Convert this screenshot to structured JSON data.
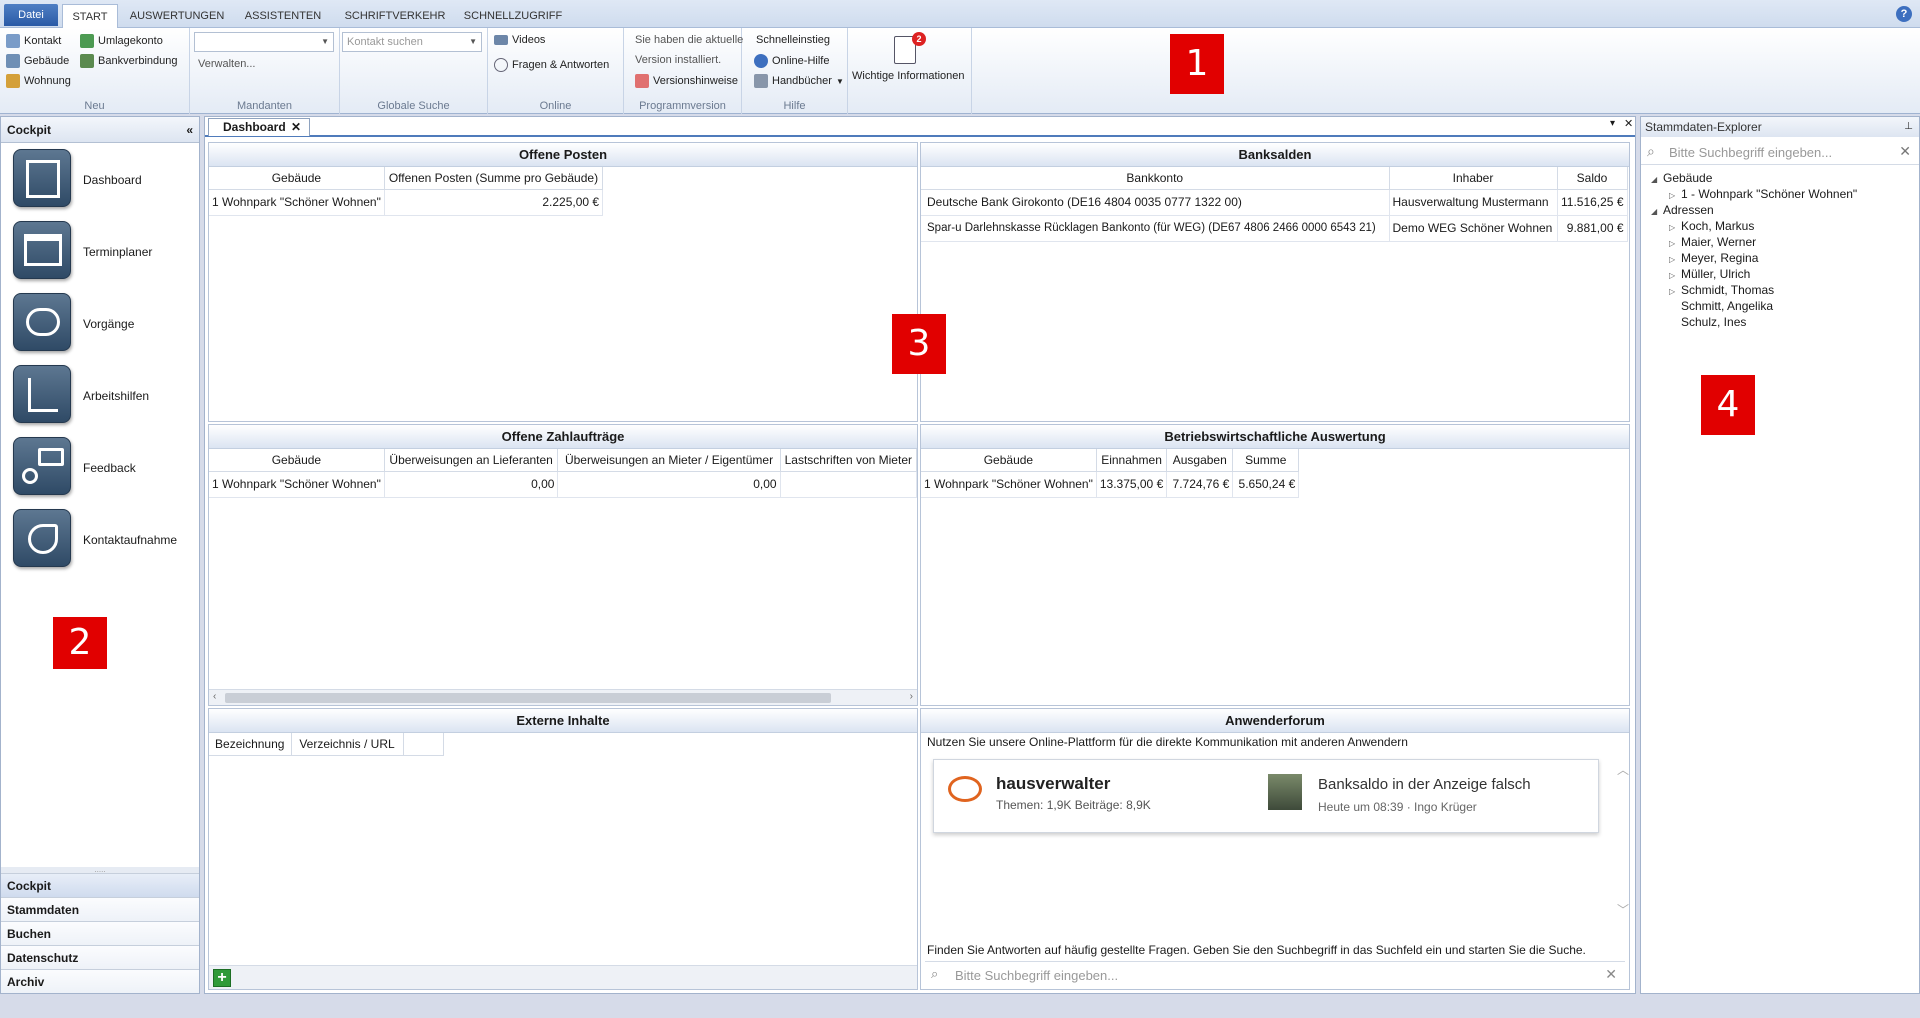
{
  "ribbon": {
    "tabs": [
      "Datei",
      "START",
      "AUSWERTUNGEN",
      "ASSISTENTEN",
      "SCHRIFTVERKEHR",
      "SCHNELLZUGRIFF"
    ],
    "groups": {
      "neu": {
        "label": "Neu",
        "items": [
          "Kontakt",
          "Gebäude",
          "Wohnung",
          "Umlagekonto",
          "Bankverbindung"
        ]
      },
      "mandanten": {
        "label": "Mandanten",
        "manage": "Verwalten..."
      },
      "suche": {
        "label": "Globale Suche",
        "placeholder": "Kontakt suchen"
      },
      "online": {
        "label": "Online",
        "items": [
          "Videos",
          "Fragen & Antworten"
        ]
      },
      "programmversion": {
        "label": "Programmversion",
        "line1": "Sie haben die aktuelle",
        "line2": "Version installiert.",
        "notes": "Versionshinweise"
      },
      "hilfe": {
        "label": "Hilfe",
        "items": [
          "Schnelleinstieg",
          "Online-Hilfe",
          "Handbücher"
        ]
      },
      "info": {
        "label": "Wichtige Informationen",
        "badge": "2"
      }
    }
  },
  "markers": [
    "1",
    "2",
    "3",
    "4"
  ],
  "cockpit": {
    "title": "Cockpit",
    "items": [
      "Dashboard",
      "Terminplaner",
      "Vorgänge",
      "Arbeitshilfen",
      "Feedback",
      "Kontaktaufnahme"
    ],
    "nav": [
      "Cockpit",
      "Stammdaten",
      "Buchen",
      "Datenschutz",
      "Archiv"
    ]
  },
  "document_tab": "Dashboard",
  "panels": {
    "offene_posten": {
      "title": "Offene Posten",
      "headers": [
        "Gebäude",
        "Offenen Posten (Summe pro Gebäude)"
      ],
      "rows": [
        [
          "1 Wohnpark \"Schöner Wohnen\"",
          "2.225,00 €"
        ]
      ]
    },
    "banksalden": {
      "title": "Banksalden",
      "headers": [
        "Bankkonto",
        "Inhaber",
        "Saldo"
      ],
      "rows": [
        [
          "Deutsche Bank Girokonto (DE16 4804 0035 0777 1322 00)",
          "Hausverwaltung Mustermann",
          "11.516,25 €"
        ],
        [
          "Spar-u Darlehnskasse Rücklagen Bankonto  (für WEG) (DE67 4806 2466 0000 6543 21)",
          "Demo WEG Schöner Wohnen",
          "9.881,00 €"
        ]
      ]
    },
    "zahlauftraege": {
      "title": "Offene Zahlaufträge",
      "headers": [
        "Gebäude",
        "Überweisungen an Lieferanten",
        "Überweisungen an Mieter / Eigentümer",
        "Lastschriften von Mieter"
      ],
      "rows": [
        [
          "1 Wohnpark \"Schöner Wohnen\"",
          "0,00",
          "0,00",
          ""
        ]
      ]
    },
    "bwa": {
      "title": "Betriebswirtschaftliche Auswertung",
      "headers": [
        "Gebäude",
        "Einnahmen",
        "Ausgaben",
        "Summe"
      ],
      "rows": [
        [
          "1 Wohnpark \"Schöner Wohnen\"",
          "13.375,00 €",
          "7.724,76 €",
          "5.650,24 €"
        ]
      ]
    },
    "extern": {
      "title": "Externe Inhalte",
      "headers": [
        "Bezeichnung",
        "Verzeichnis / URL",
        ""
      ]
    },
    "forum": {
      "title": "Anwenderforum",
      "intro": "Nutzen Sie unsere Online-Plattform für die direkte Kommunikation mit anderen Anwendern",
      "brand": "hausverwalter",
      "stats": "Themen: 1,9K Beiträge: 8,9K",
      "post_title": "Banksaldo in der Anzeige falsch",
      "post_meta": "Heute um 08:39 · Ingo Krüger",
      "faq": "Finden Sie Antworten auf häufig gestellte Fragen. Geben Sie den Suchbegriff in das Suchfeld ein und starten Sie die Suche.",
      "search_placeholder": "Bitte Suchbegriff eingeben..."
    }
  },
  "explorer": {
    "title": "Stammdaten-Explorer",
    "search_placeholder": "Bitte Suchbegriff eingeben...",
    "tree": {
      "gebaeude": "Gebäude",
      "gebaeude_children": [
        "1 - Wohnpark \"Schöner Wohnen\""
      ],
      "adressen": "Adressen",
      "adressen_children": [
        "Koch, Markus",
        "Maier, Werner",
        "Meyer, Regina",
        "Müller, Ulrich",
        "Schmidt, Thomas",
        "Schmitt, Angelika",
        "Schulz, Ines"
      ]
    }
  }
}
